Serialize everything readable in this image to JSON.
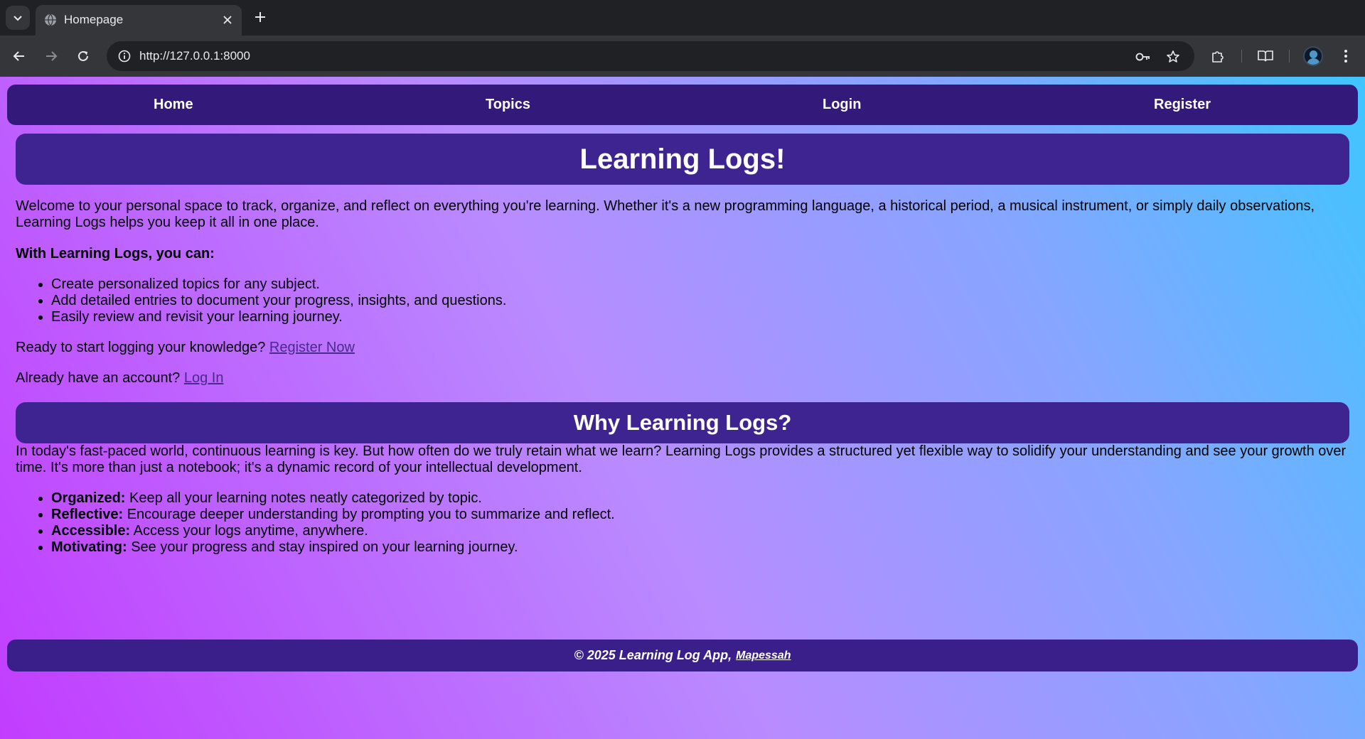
{
  "browser": {
    "tab_title": "Homepage",
    "url": "http://127.0.0.1:8000",
    "icons": [
      "tab-list-icon",
      "globe-icon",
      "close-icon",
      "plus-icon",
      "back-icon",
      "forward-icon",
      "reload-icon",
      "info-icon",
      "key-icon",
      "star-icon",
      "extensions-icon",
      "reading-mode-icon",
      "profile-avatar",
      "kebab-menu-icon"
    ]
  },
  "nav": {
    "home": "Home",
    "topics": "Topics",
    "login": "Login",
    "register": "Register"
  },
  "hero": {
    "title": "Learning Logs!",
    "intro": "Welcome to your personal space to track, organize, and reflect on everything you're learning. Whether it's a new programming language, a historical period, a musical instrument, or simply daily observations, Learning Logs helps you keep it all in one place.",
    "features_heading": "With Learning Logs, you can:",
    "features": [
      "Create personalized topics for any subject.",
      "Add detailed entries to document your progress, insights, and questions.",
      "Easily review and revisit your learning journey."
    ],
    "register_prompt": "Ready to start logging your knowledge?",
    "register_link": "Register Now",
    "login_prompt": "Already have an account?",
    "login_link": "Log In"
  },
  "why": {
    "title": "Why Learning Logs?",
    "body": "In today's fast-paced world, continuous learning is key. But how often do we truly retain what we learn? Learning Logs provides a structured yet flexible way to solidify your understanding and see your growth over time. It's more than just a notebook; it's a dynamic record of your intellectual development.",
    "points": [
      {
        "label": "Organized:",
        "text": "Keep all your learning notes neatly categorized by topic."
      },
      {
        "label": "Reflective:",
        "text": "Encourage deeper understanding by prompting you to summarize and reflect."
      },
      {
        "label": "Accessible:",
        "text": "Access your logs anytime, anywhere."
      },
      {
        "label": "Motivating:",
        "text": "See your progress and stay inspired on your learning journey."
      }
    ]
  },
  "footer": {
    "text": "© 2025 Learning Log App,",
    "link": "Mapessah"
  }
}
